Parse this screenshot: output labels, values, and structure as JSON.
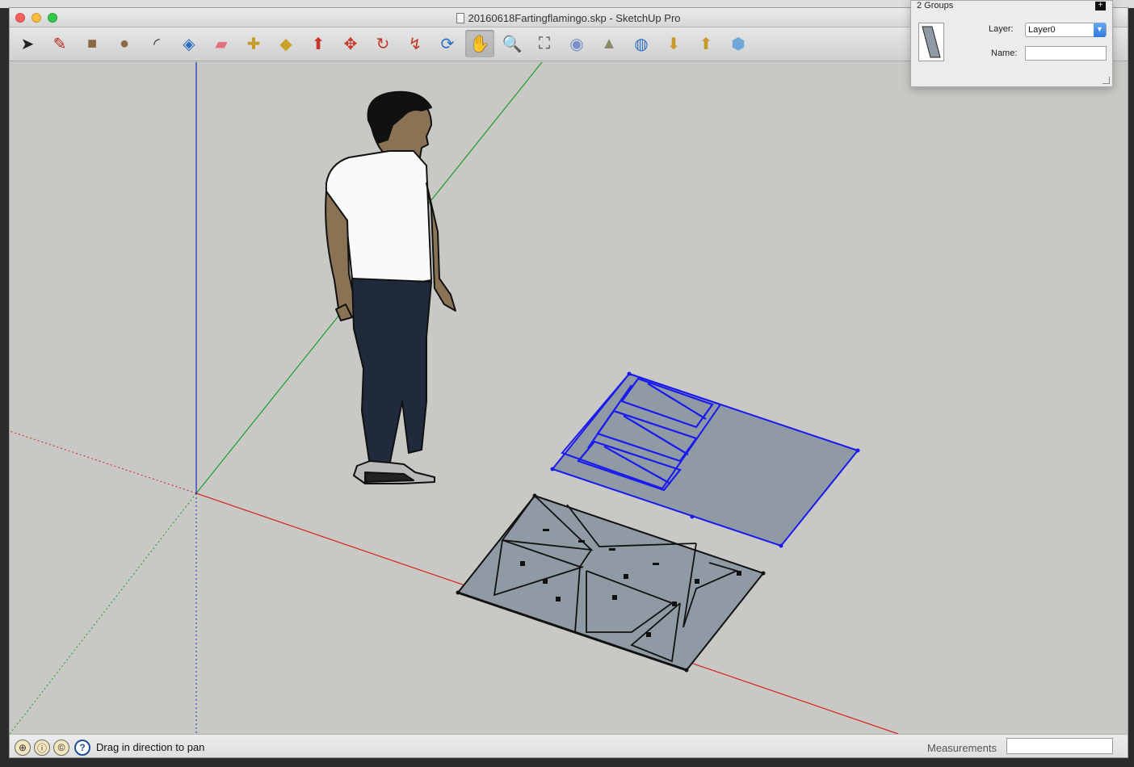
{
  "window": {
    "title": "20160618Fartingflamingo.skp - SketchUp Pro",
    "traffic_lights": {
      "close": "#fc605c",
      "minimize": "#fdbc40",
      "zoom": "#34c84a"
    }
  },
  "toolbar": {
    "tools": [
      {
        "id": "select",
        "glyph": "➤",
        "icon": "select-arrow-icon",
        "color": "#222"
      },
      {
        "id": "pencil",
        "glyph": "✎",
        "icon": "pencil-icon",
        "color": "#b32a1e"
      },
      {
        "id": "rectangle",
        "glyph": "■",
        "icon": "rectangle-icon",
        "color": "#8a6a42"
      },
      {
        "id": "circle",
        "glyph": "●",
        "icon": "circle-icon",
        "color": "#8a6a42"
      },
      {
        "id": "arc",
        "glyph": "◜",
        "icon": "arc-icon",
        "color": "#333"
      },
      {
        "id": "push-pull-face",
        "glyph": "◈",
        "icon": "make-component-icon",
        "color": "#2f6fc2"
      },
      {
        "id": "eraser",
        "glyph": "▰",
        "icon": "eraser-icon",
        "color": "#e1717f"
      },
      {
        "id": "tape-measure",
        "glyph": "✚",
        "icon": "tape-measure-icon",
        "color": "#c89a2a"
      },
      {
        "id": "paint-bucket",
        "glyph": "◆",
        "icon": "paint-bucket-icon",
        "color": "#c9a227"
      },
      {
        "id": "push-pull",
        "glyph": "⬆",
        "icon": "push-pull-icon",
        "color": "#c4372a"
      },
      {
        "id": "move",
        "glyph": "✥",
        "icon": "move-icon",
        "color": "#c4372a"
      },
      {
        "id": "rotate",
        "glyph": "↻",
        "icon": "rotate-icon",
        "color": "#c4372a"
      },
      {
        "id": "offset",
        "glyph": "↯",
        "icon": "offset-icon",
        "color": "#c4372a"
      },
      {
        "id": "orbit",
        "glyph": "⟳",
        "icon": "orbit-icon",
        "color": "#2f6fc2"
      },
      {
        "id": "pan",
        "glyph": "✋",
        "icon": "pan-hand-icon",
        "color": "#ffffff",
        "active": true
      },
      {
        "id": "zoom",
        "glyph": "🔍",
        "icon": "zoom-icon",
        "color": "#333"
      },
      {
        "id": "zoom-extents",
        "glyph": "⛶",
        "icon": "zoom-extents-icon",
        "color": "#333"
      },
      {
        "id": "previous",
        "glyph": "◉",
        "icon": "previous-view-icon",
        "color": "#7a8fc8"
      },
      {
        "id": "position-camera",
        "glyph": "▲",
        "icon": "position-camera-icon",
        "color": "#8a8a6a"
      },
      {
        "id": "3d-warehouse",
        "glyph": "◍",
        "icon": "warehouse-icon",
        "color": "#2f6fc2"
      },
      {
        "id": "share-model",
        "glyph": "⬇",
        "icon": "share-model-icon",
        "color": "#c89a2a"
      },
      {
        "id": "get-models",
        "glyph": "⬆",
        "icon": "get-models-icon",
        "color": "#c89a2a"
      },
      {
        "id": "extension",
        "glyph": "⬢",
        "icon": "extension-warehouse-icon",
        "color": "#6fa8d8"
      }
    ]
  },
  "status": {
    "message": "Drag in direction to pan",
    "icons": [
      "geo-location-icon",
      "credits-icon",
      "user-icon"
    ],
    "help_glyph": "?",
    "measurements_label": "Measurements",
    "measurements_value": ""
  },
  "entity_info": {
    "title": "2 Groups",
    "plus_glyph": "+",
    "layer_label": "Layer:",
    "layer_value": "Layer0",
    "name_label": "Name:",
    "name_value": ""
  },
  "scene": {
    "axis_colors": {
      "red": "#d42020",
      "green": "#1e9a2a",
      "blue": "#1c2fcc"
    },
    "selection_color": "#1a1af0",
    "plate_fill": "#8f9aa4"
  }
}
